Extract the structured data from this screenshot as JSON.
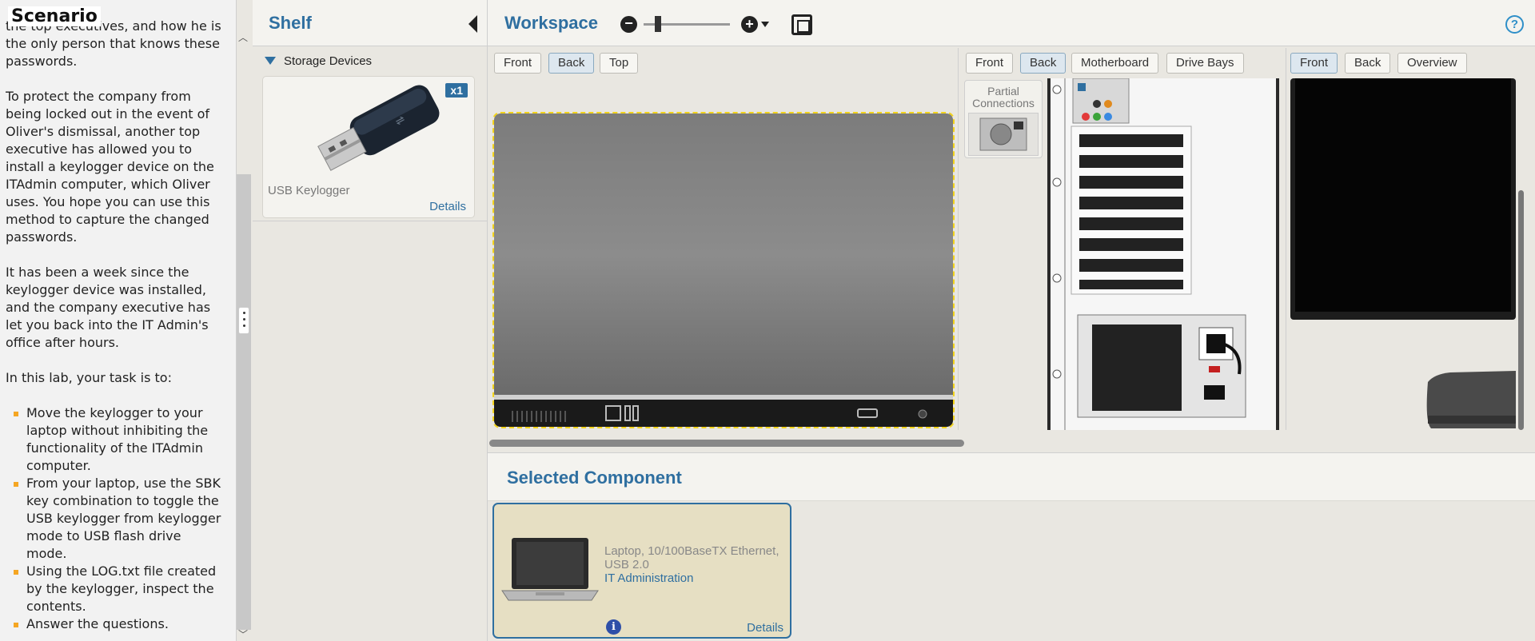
{
  "scenario": {
    "title": "Scenario",
    "paragraphs": [
      "the top executives, and how he is the only person that knows these passwords.",
      "To protect the company from being locked out in the event of Oliver's dismissal, another top executive has allowed you to install a keylogger device on the ITAdmin computer, which Oliver uses. You hope you can use this method to capture the changed passwords.",
      "It has been a week since the keylogger device was installed, and the company executive has let you back into the IT Admin's office after hours.",
      "In this lab, your task is to:"
    ],
    "tasks": [
      "Move the keylogger to your laptop without inhibiting the functionality of the ITAdmin computer.",
      "From your laptop, use the SBK key combination to toggle the USB keylogger from keylogger mode to USB flash drive mode.",
      "Using the LOG.txt file created by the keylogger, inspect the contents.",
      "Answer the questions."
    ]
  },
  "shelf": {
    "title": "Shelf",
    "group": "Storage Devices",
    "device": {
      "name": "USB Keylogger",
      "badge": "x1",
      "details": "Details"
    }
  },
  "workspace": {
    "title": "Workspace",
    "help": "?",
    "laptop_views": [
      "Front",
      "Back",
      "Top"
    ],
    "laptop_active": "Back",
    "pc_views": [
      "Front",
      "Back",
      "Motherboard",
      "Drive Bays"
    ],
    "pc_active": "Back",
    "monitor_views": [
      "Front",
      "Back",
      "Overview"
    ],
    "monitor_active": "Front",
    "partial_label": "Partial Connections"
  },
  "selected": {
    "title": "Selected Component",
    "description": "Laptop, 10/100BaseTX Ethernet, USB 2.0",
    "location": "IT Administration",
    "details": "Details",
    "info": "i"
  },
  "colors": {
    "accent": "#2f6fa0",
    "bullet": "#f5a623",
    "selection_outline": "#f2d31b"
  }
}
